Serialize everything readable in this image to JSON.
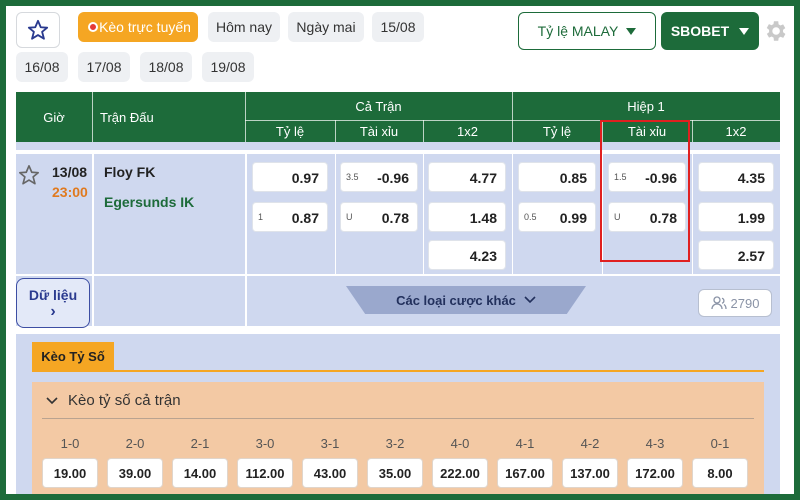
{
  "topbar": {
    "live_label": "Kèo trực tuyến",
    "dates_row1": [
      "Hôm nay",
      "Ngày mai",
      "15/08"
    ],
    "dates_row2": [
      "16/08",
      "17/08",
      "18/08",
      "19/08"
    ],
    "odds_format": "Tỷ lệ MALAY",
    "bookmaker": "SBOBET"
  },
  "table": {
    "col_time": "Giờ",
    "col_match": "Trận Đấu",
    "group_full": "Cả Trận",
    "group_half": "Hiệp 1",
    "sub_cols": [
      "Tỷ lệ",
      "Tài xỉu",
      "1x2"
    ]
  },
  "match": {
    "date": "13/08",
    "time": "23:00",
    "home": "Floy FK",
    "away": "Egersunds IK",
    "full": {
      "handicap": [
        {
          "h": "",
          "v": "0.97"
        },
        {
          "h": "1",
          "v": "0.87"
        }
      ],
      "overunder": [
        {
          "h": "3.5",
          "v": "-0.96"
        },
        {
          "h": "U",
          "v": "0.78"
        }
      ],
      "x12": [
        "4.77",
        "1.48",
        "4.23"
      ]
    },
    "half": {
      "handicap": [
        {
          "h": "",
          "v": "0.85"
        },
        {
          "h": "0.5",
          "v": "0.99"
        }
      ],
      "overunder": [
        {
          "h": "1.5",
          "v": "-0.96"
        },
        {
          "h": "U",
          "v": "0.78"
        }
      ],
      "x12": [
        "4.35",
        "1.99",
        "2.57"
      ]
    }
  },
  "actions": {
    "data_label_1": "Dữ liệu",
    "data_label_2": "›",
    "more_bets": "Các loại cược khác",
    "count": "2790"
  },
  "correct_score": {
    "tab": "Kèo Tỷ Số",
    "panel_title": "Kèo tỷ số cả trận",
    "scores": [
      "1-0",
      "2-0",
      "2-1",
      "3-0",
      "3-1",
      "3-2",
      "4-0",
      "4-1",
      "4-2",
      "4-3",
      "0-1"
    ],
    "odds": [
      "19.00",
      "39.00",
      "14.00",
      "112.00",
      "43.00",
      "35.00",
      "222.00",
      "167.00",
      "137.00",
      "172.00",
      "8.00"
    ]
  },
  "colors": {
    "brand_green": "#1d6b3a",
    "accent_orange": "#f5a623",
    "highlight_red": "#e02020",
    "row_bg": "#cfd8ef"
  }
}
